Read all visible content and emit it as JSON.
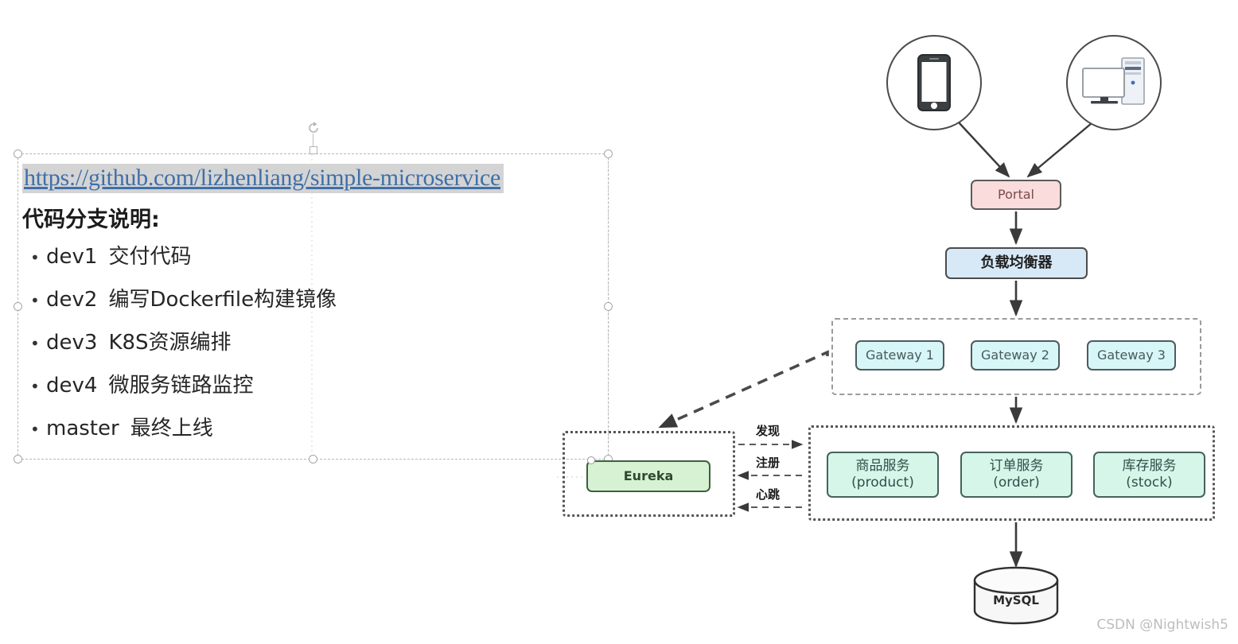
{
  "slide": {
    "text_box": {
      "link": "https://github.com/lizhenliang/simple-microservice",
      "heading": "代码分支说明:",
      "bullet_glyph": "•",
      "items": [
        {
          "code": "dev1",
          "desc": "交付代码"
        },
        {
          "code": "dev2",
          "desc": "编写Dockerfile构建镜像"
        },
        {
          "code": "dev3",
          "desc": "K8S资源编排"
        },
        {
          "code": "dev4",
          "desc": "微服务链路监控"
        },
        {
          "code": "master",
          "desc": "最终上线"
        }
      ]
    }
  },
  "diagram": {
    "clients": {
      "phone_icon": "smartphone-icon",
      "pc_icon": "desktop-computer-icon"
    },
    "portal": {
      "label": "Portal",
      "fill": "#fadcdc",
      "stroke": "#5b5b5b",
      "text_color": "#7a4b4b"
    },
    "load_balancer": {
      "label": "负载均衡器",
      "fill": "#d7e9f7",
      "stroke": "#4c4c4c"
    },
    "gateways": [
      {
        "label": "Gateway 1"
      },
      {
        "label": "Gateway 2"
      },
      {
        "label": "Gateway 3"
      }
    ],
    "gateway_group": {
      "border_style": "dashed",
      "fill": "#d7f6f7"
    },
    "registry": {
      "label": "Eureka",
      "fill": "#d7f2d3",
      "stroke": "#3f5f3f",
      "group_border_style": "dotted"
    },
    "registry_flows": [
      {
        "label": "发现",
        "direction": "registry-to-service"
      },
      {
        "label": "注册",
        "direction": "service-to-registry"
      },
      {
        "label": "心跳",
        "direction": "service-to-registry"
      }
    ],
    "services": [
      {
        "cn": "商品服务",
        "en": "(product)"
      },
      {
        "cn": "订单服务",
        "en": "(order)"
      },
      {
        "cn": "库存服务",
        "en": "(stock)"
      }
    ],
    "service_group": {
      "border_style": "dotted",
      "fill": "#d7f6ea"
    },
    "database": {
      "label": "MySQL",
      "shape": "cylinder"
    }
  },
  "watermark": "CSDN @Nightwish5"
}
